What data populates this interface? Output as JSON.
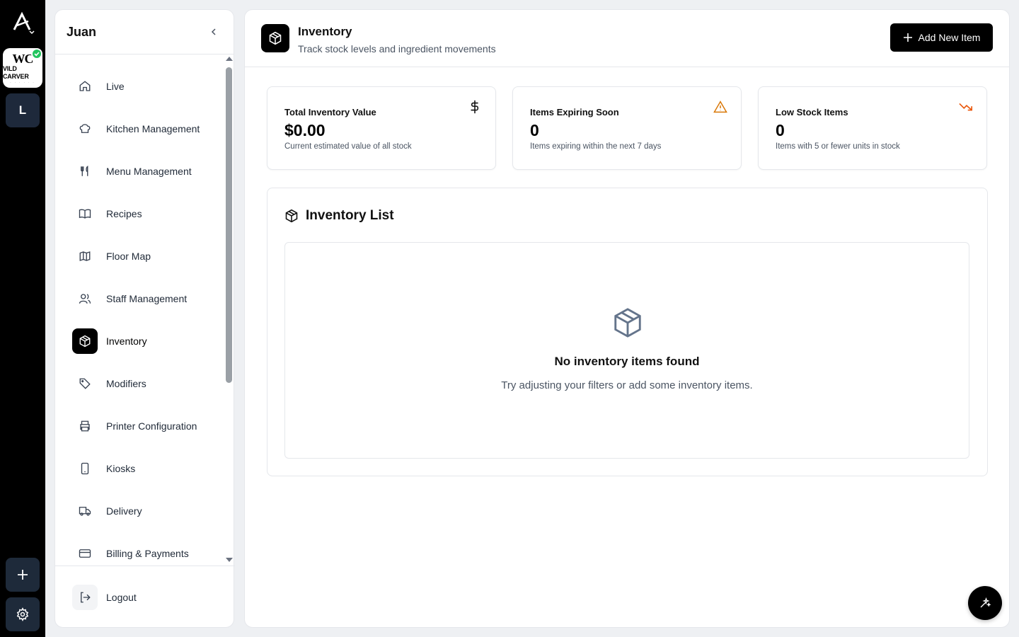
{
  "rail": {
    "brand_monogram": "WC",
    "brand_name": "VILD CARVER",
    "brand_tagline": "· · · · · ·",
    "workspace_initial": "L",
    "icons": [
      "app-logo-icon",
      "check-icon",
      "plus-icon",
      "gear-icon"
    ]
  },
  "sidebar": {
    "title": "Juan",
    "items": [
      {
        "label": "Live",
        "icon": "home-icon"
      },
      {
        "label": "Kitchen Management",
        "icon": "chef-hat-icon"
      },
      {
        "label": "Menu Management",
        "icon": "utensils-icon"
      },
      {
        "label": "Recipes",
        "icon": "book-icon"
      },
      {
        "label": "Floor Map",
        "icon": "map-icon"
      },
      {
        "label": "Staff Management",
        "icon": "users-icon"
      },
      {
        "label": "Inventory",
        "icon": "package-icon",
        "active": true
      },
      {
        "label": "Modifiers",
        "icon": "tag-icon"
      },
      {
        "label": "Printer Configuration",
        "icon": "printer-icon"
      },
      {
        "label": "Kiosks",
        "icon": "tablet-icon"
      },
      {
        "label": "Delivery",
        "icon": "truck-icon"
      },
      {
        "label": "Billing & Payments",
        "icon": "credit-card-icon"
      }
    ],
    "logout_label": "Logout"
  },
  "header": {
    "title": "Inventory",
    "subtitle": "Track stock levels and ingredient movements",
    "add_button_label": "Add New Item"
  },
  "stats": [
    {
      "title": "Total Inventory Value",
      "value": "$0.00",
      "subtitle": "Current estimated value of all stock",
      "icon": "dollar-icon",
      "icon_color": "#111111"
    },
    {
      "title": "Items Expiring Soon",
      "value": "0",
      "subtitle": "Items expiring within the next 7 days",
      "icon": "warning-triangle-icon",
      "icon_color": "#d97706"
    },
    {
      "title": "Low Stock Items",
      "value": "0",
      "subtitle": "Items with 5 or fewer units in stock",
      "icon": "trending-down-icon",
      "icon_color": "#ea580c"
    }
  ],
  "inventory_list": {
    "title": "Inventory List",
    "empty_title": "No inventory items found",
    "empty_subtitle": "Try adjusting your filters or add some inventory items."
  },
  "colors": {
    "accent": "#000000",
    "rail_bg": "#000000",
    "rail_button": "#1e2a3a",
    "success": "#22c55e",
    "warning": "#d97706",
    "danger": "#ea580c"
  }
}
